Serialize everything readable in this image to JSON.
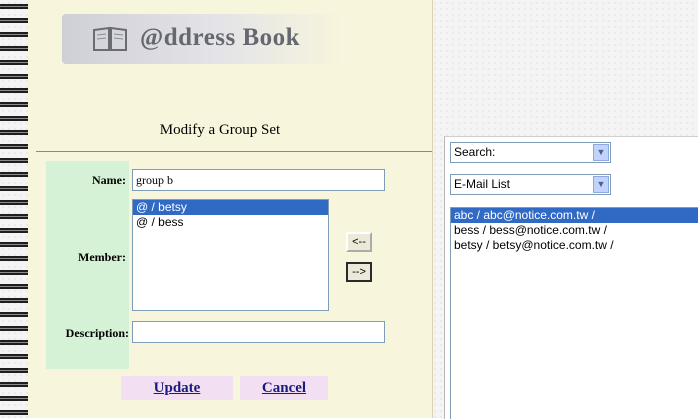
{
  "app": {
    "logo_text": "@ddress Book"
  },
  "form": {
    "title": "Modify a Group Set",
    "labels": {
      "name": "Name:",
      "member": "Member:",
      "description": "Description:"
    },
    "name_value": "group b",
    "description_value": "",
    "members": [
      {
        "label": "@ / betsy",
        "selected": true
      },
      {
        "label": "@ / bess",
        "selected": false
      }
    ],
    "move_left_label": "<--",
    "move_right_label": "-->",
    "update_label": "Update",
    "cancel_label": "Cancel"
  },
  "right_panel": {
    "search_select": "Search:",
    "list_select": "E-Mail List",
    "emails": [
      {
        "label": "abc / abc@notice.com.tw /",
        "selected": true
      },
      {
        "label": "bess / bess@notice.com.tw /",
        "selected": false
      },
      {
        "label": "betsy / betsy@notice.com.tw /",
        "selected": false
      }
    ]
  },
  "icons": {
    "logo": "book-icon",
    "dropdown": "chevron-down-icon"
  },
  "colors": {
    "page": "#f7f5dc",
    "label_column": "#d6f2d6",
    "action_button": "#f2dff2",
    "selection": "#316ac5"
  }
}
